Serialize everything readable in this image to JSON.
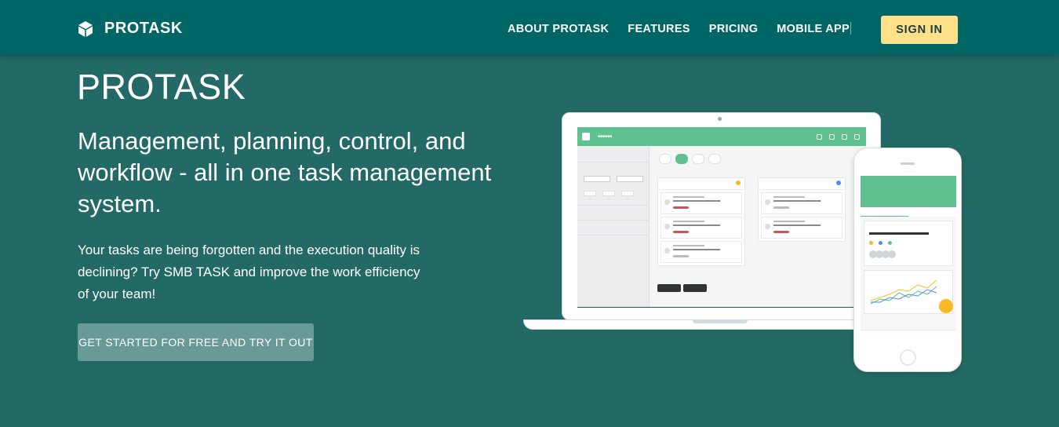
{
  "brand": {
    "name": "PROTASK",
    "icon": "cube-logo-icon"
  },
  "nav": {
    "links": [
      "ABOUT PROTASK",
      "FEATURES",
      "PRICING",
      "MOBILE APP"
    ],
    "signin_label": "SIGN IN"
  },
  "hero": {
    "title": "PROTASK",
    "subtitle": "Management, planning, control, and workflow - all in one task management system.",
    "description": "Your tasks are being forgotten and the execution quality is declining? Try SMB TASK and improve the work efficiency of your team!",
    "cta_label": "GET STARTED FOR FREE AND TRY IT OUT"
  },
  "colors": {
    "background": "#236965",
    "nav": "#006565",
    "signin": "#ffe08a",
    "cta": "#6a9a97",
    "app_accent": "#5fc18f"
  }
}
